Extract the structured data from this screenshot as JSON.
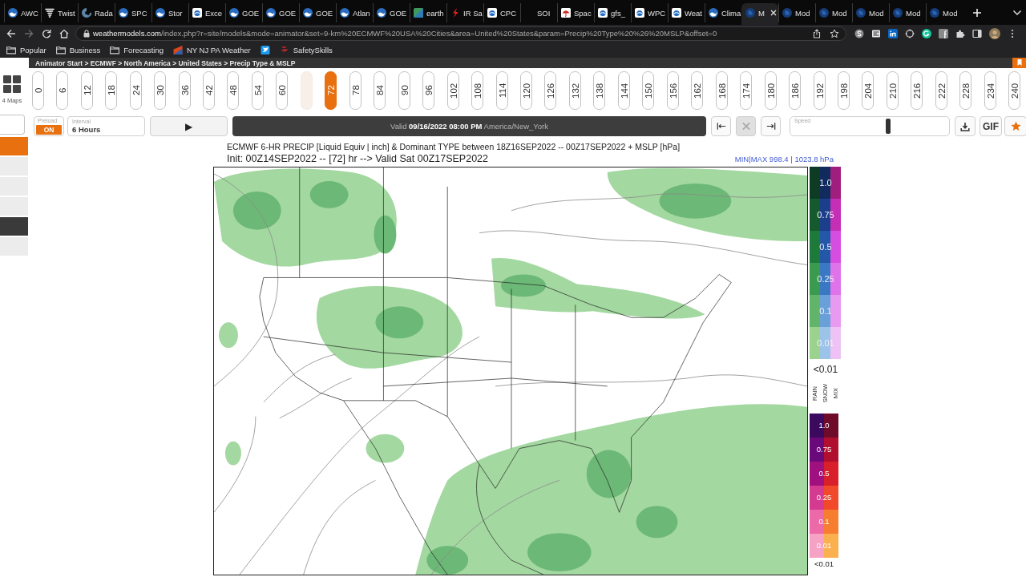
{
  "browser": {
    "tabs": [
      {
        "title": "AWC",
        "kind": "emblem",
        "selected": false
      },
      {
        "title": "Twist",
        "kind": "tornado",
        "selected": false
      },
      {
        "title": "Rada",
        "kind": "swirl",
        "selected": false
      },
      {
        "title": "SPC",
        "kind": "emblem",
        "selected": false
      },
      {
        "title": "Stor",
        "kind": "emblem",
        "selected": false
      },
      {
        "title": "Exce",
        "kind": "tile",
        "selected": false
      },
      {
        "title": "GOE",
        "kind": "emblem",
        "selected": false
      },
      {
        "title": "GOE",
        "kind": "emblem",
        "selected": false
      },
      {
        "title": "GOE",
        "kind": "emblem",
        "selected": false
      },
      {
        "title": "Atlan",
        "kind": "emblem",
        "selected": false
      },
      {
        "title": "GOE",
        "kind": "emblem",
        "selected": false
      },
      {
        "title": "earth",
        "kind": "square",
        "selected": false
      },
      {
        "title": "IR Sa",
        "kind": "bolt",
        "selected": false
      },
      {
        "title": "CPC",
        "kind": "tile",
        "selected": false
      },
      {
        "title": "SOI",
        "kind": "none",
        "selected": false
      },
      {
        "title": "Spac",
        "kind": "umbrella",
        "selected": false
      },
      {
        "title": "gfs_",
        "kind": "tile",
        "selected": false
      },
      {
        "title": "WPC",
        "kind": "tile",
        "selected": false
      },
      {
        "title": "Weat",
        "kind": "tile",
        "selected": false
      },
      {
        "title": "Clima",
        "kind": "emblem",
        "selected": false
      },
      {
        "title": "M",
        "kind": "globe",
        "selected": true
      },
      {
        "title": "Mod",
        "kind": "globe",
        "selected": false
      },
      {
        "title": "Mod",
        "kind": "globe",
        "selected": false
      },
      {
        "title": "Mod",
        "kind": "globe",
        "selected": false
      },
      {
        "title": "Mod",
        "kind": "globe",
        "selected": false
      },
      {
        "title": "Mod",
        "kind": "globe",
        "selected": false
      }
    ],
    "address_bar": {
      "host": "weathermodels.com",
      "path": "/index.php?r=site/models&mode=animator&set=9-km%20ECMWF%20USA%20Cities&area=United%20States&param=Precip%20Type%20%26%20MSLP&offset=0"
    },
    "bookmarks": [
      {
        "label": "Popular",
        "kind": "folder"
      },
      {
        "label": "Business",
        "kind": "folder"
      },
      {
        "label": "Forecasting",
        "kind": "folder"
      },
      {
        "label": "NY NJ PA Weather",
        "kind": "diagonal"
      },
      {
        "kind": "bird"
      },
      {
        "label": "SafetySkills",
        "kind": "stripes"
      }
    ]
  },
  "page": {
    "breadcrumb": "Animator Start > ECMWF > North America > United States > Precip Type & MSLP",
    "layout_button": "4 Maps",
    "sidebar": {
      "items": [
        {
          "selected": true,
          "hovered": false
        },
        {
          "selected": false,
          "hovered": false
        },
        {
          "selected": false,
          "hovered": false
        },
        {
          "selected": false,
          "hovered": false
        },
        {
          "selected": false,
          "hovered": true
        },
        {
          "selected": false,
          "hovered": false
        }
      ]
    },
    "timeline": {
      "frames": [
        {
          "kind": "hour",
          "label": "0",
          "selected": false
        },
        {
          "kind": "hour",
          "label": "6",
          "selected": false
        },
        {
          "kind": "hour",
          "label": "12",
          "selected": false
        },
        {
          "kind": "hour",
          "label": "18",
          "selected": false
        },
        {
          "kind": "hour",
          "label": "24",
          "selected": false
        },
        {
          "kind": "hour",
          "label": "30",
          "selected": false
        },
        {
          "kind": "hour",
          "label": "36",
          "selected": false
        },
        {
          "kind": "hour",
          "label": "42",
          "selected": false
        },
        {
          "kind": "hour",
          "label": "48",
          "selected": false
        },
        {
          "kind": "hour",
          "label": "54",
          "selected": false
        },
        {
          "kind": "hour",
          "label": "60",
          "selected": false
        },
        {
          "kind": "ghost",
          "selected": false
        },
        {
          "kind": "hour",
          "label": "72",
          "selected": true
        },
        {
          "kind": "hour",
          "label": "78",
          "selected": false
        },
        {
          "kind": "hour",
          "label": "84",
          "selected": false
        },
        {
          "kind": "hour",
          "label": "90",
          "selected": false
        },
        {
          "kind": "hour",
          "label": "96",
          "selected": false
        },
        {
          "kind": "hour",
          "label": "102",
          "selected": false
        },
        {
          "kind": "hour",
          "label": "108",
          "selected": false
        },
        {
          "kind": "hour",
          "label": "114",
          "selected": false
        },
        {
          "kind": "hour",
          "label": "120",
          "selected": false
        },
        {
          "kind": "hour",
          "label": "126",
          "selected": false
        },
        {
          "kind": "hour",
          "label": "132",
          "selected": false
        },
        {
          "kind": "hour",
          "label": "138",
          "selected": false
        },
        {
          "kind": "hour",
          "label": "144",
          "selected": false
        },
        {
          "kind": "hour",
          "label": "150",
          "selected": false
        },
        {
          "kind": "hour",
          "label": "156",
          "selected": false
        },
        {
          "kind": "hour",
          "label": "162",
          "selected": false
        },
        {
          "kind": "hour",
          "label": "168",
          "selected": false
        },
        {
          "kind": "hour",
          "label": "174",
          "selected": false
        },
        {
          "kind": "hour",
          "label": "180",
          "selected": false
        },
        {
          "kind": "hour",
          "label": "186",
          "selected": false
        },
        {
          "kind": "hour",
          "label": "192",
          "selected": false
        },
        {
          "kind": "hour",
          "label": "198",
          "selected": false
        },
        {
          "kind": "hour",
          "label": "204",
          "selected": false
        },
        {
          "kind": "hour",
          "label": "210",
          "selected": false
        },
        {
          "kind": "hour",
          "label": "216",
          "selected": false
        },
        {
          "kind": "hour",
          "label": "222",
          "selected": false
        },
        {
          "kind": "hour",
          "label": "228",
          "selected": false
        },
        {
          "kind": "hour",
          "label": "234",
          "selected": false
        },
        {
          "kind": "hour",
          "label": "240",
          "selected": false
        }
      ]
    },
    "controls": {
      "preload": {
        "label": "Preload",
        "value": "ON",
        "on": true
      },
      "interval": {
        "label": "Interval",
        "value": "6 Hours"
      },
      "play_button": "▶",
      "valid_time": "Valid **09/16/2022 08:00 PM** America/New_York",
      "nav_buttons": [
        {
          "kind": "first",
          "disabled": false
        },
        {
          "kind": "stop",
          "disabled": true
        },
        {
          "kind": "last",
          "disabled": false
        }
      ],
      "speed": {
        "label": "Speed",
        "level": 0.6
      },
      "gif_button": "GIF",
      "favorite": {
        "on": true
      }
    },
    "map": {
      "title": "ECMWF 6-HR PRECIP [Liquid Equiv | inch] & Dominant TYPE between 18Z16SEP2022 -- 00Z17SEP2022 + MSLP [hPa]",
      "subtitle": "Init: 00Z14SEP2022 -- [72] hr --> Valid Sat 00Z17SEP2022",
      "range": "MIN|MAX 998.4 | 1023.8 hPa"
    },
    "legend_precip": {
      "rows": [
        {
          "label": "1.0",
          "swatches": [
            {
              "color": "#0d3b24"
            },
            {
              "color": "#122b5e"
            },
            {
              "color": "#a01f7e"
            }
          ]
        },
        {
          "label": "0.75",
          "swatches": [
            {
              "color": "#145a2e"
            },
            {
              "color": "#1b3f8a"
            },
            {
              "color": "#c52fb5"
            }
          ]
        },
        {
          "label": "0.5",
          "swatches": [
            {
              "color": "#1e7a3a"
            },
            {
              "color": "#2357a8"
            },
            {
              "color": "#d64ee0"
            }
          ]
        },
        {
          "label": "0.25",
          "swatches": [
            {
              "color": "#3a9a50"
            },
            {
              "color": "#3b78c4"
            },
            {
              "color": "#de73ea"
            }
          ]
        },
        {
          "label": "0.1",
          "swatches": [
            {
              "color": "#62b46a"
            },
            {
              "color": "#6aa0d8"
            },
            {
              "color": "#e79af0"
            }
          ]
        },
        {
          "label": "0.01",
          "swatches": [
            {
              "color": "#9ad28e"
            },
            {
              "color": "#9cc4e8"
            },
            {
              "color": "#efc2f6"
            }
          ]
        }
      ],
      "below": "<0.01",
      "types": [
        "RAIN",
        "SNOW",
        "MIX"
      ]
    },
    "legend_mixed": {
      "rows": [
        {
          "label": "1.0",
          "swatches": [
            {
              "color": "#3b0a5e"
            },
            {
              "color": "#6e0a2a"
            }
          ]
        },
        {
          "label": "0.75",
          "swatches": [
            {
              "color": "#6a0a7a"
            },
            {
              "color": "#b0102e"
            }
          ]
        },
        {
          "label": "0.5",
          "swatches": [
            {
              "color": "#a0107f"
            },
            {
              "color": "#d8202a"
            }
          ]
        },
        {
          "label": "0.25",
          "swatches": [
            {
              "color": "#d33a90"
            },
            {
              "color": "#f04a2a"
            }
          ]
        },
        {
          "label": "0.1",
          "swatches": [
            {
              "color": "#ec6aa8"
            },
            {
              "color": "#f77e30"
            }
          ]
        },
        {
          "label": "0.01",
          "swatches": [
            {
              "color": "#f6a2c4"
            },
            {
              "color": "#fbb050"
            }
          ]
        }
      ],
      "below": "<0.01"
    }
  }
}
